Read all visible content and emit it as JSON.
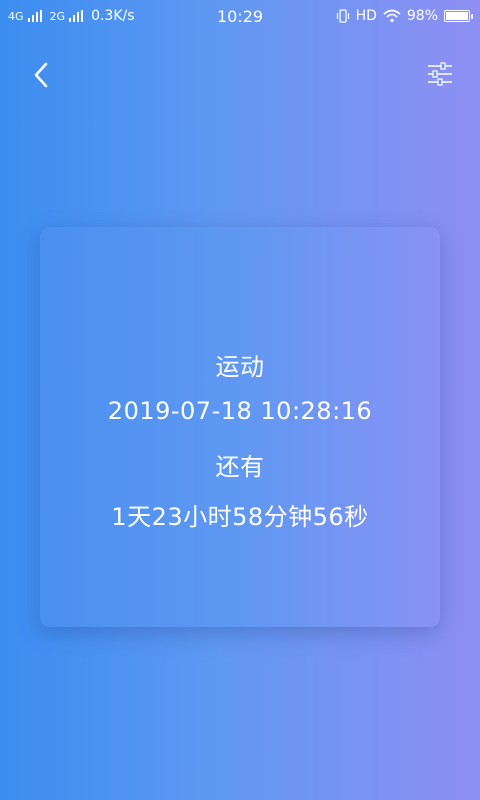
{
  "status_bar": {
    "net1": "4G",
    "net2": "2G",
    "speed": "0.3K/s",
    "time": "10:29",
    "hd": "HD",
    "battery_percent": "98%",
    "battery_level": 0.98
  },
  "header": {
    "back_icon": "chevron-left-icon",
    "filter_icon": "sliders-icon"
  },
  "card": {
    "event_name": "运动",
    "event_datetime": "2019-07-18 10:28:16",
    "remaining_label": "还有",
    "countdown": "1天23小时58分钟56秒"
  },
  "colors": {
    "gradient_start": "#3b8df0",
    "gradient_end": "#8f8ff3",
    "text": "#ffffff"
  }
}
